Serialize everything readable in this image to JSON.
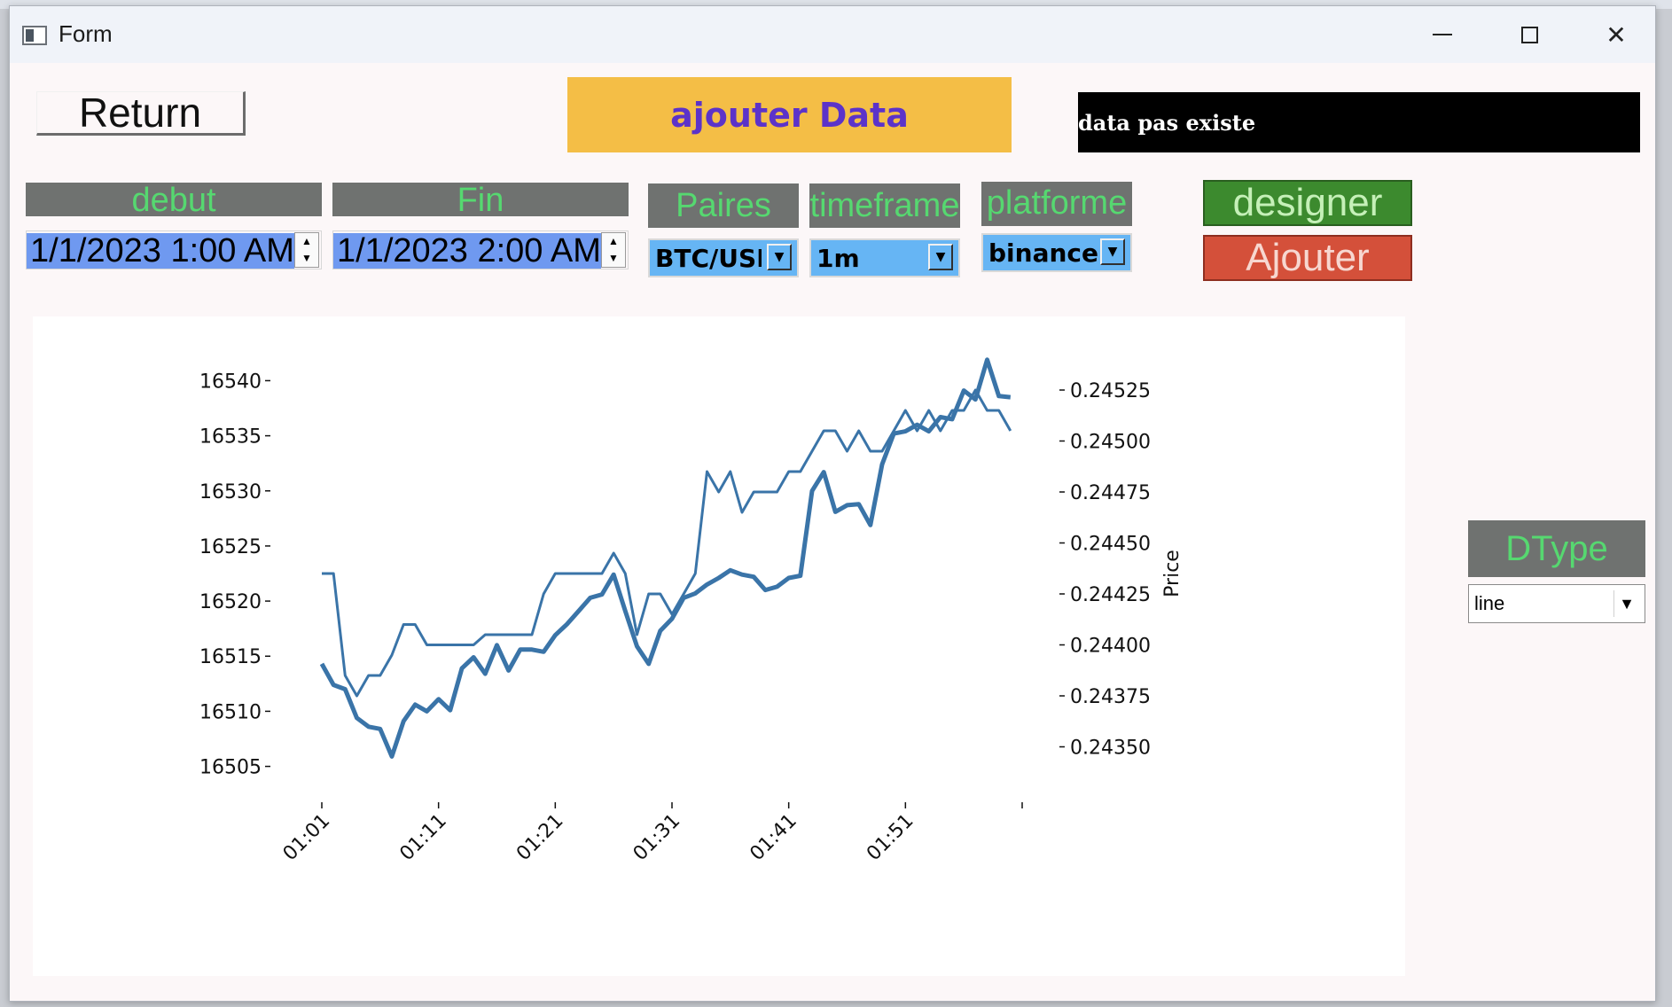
{
  "window": {
    "title": "Form"
  },
  "toolbar": {
    "return_label": "Return",
    "ajouter_data_label": "ajouter Data",
    "status_text": "data pas existe",
    "designer_label": "designer",
    "ajouter_label": "Ajouter"
  },
  "filters": {
    "debut_label": "debut",
    "debut_value": "1/1/2023 1:00 AM",
    "fin_label": "Fin",
    "fin_value": "1/1/2023 2:00 AM",
    "paires_label": "Paires",
    "paires_value": "BTC/USDT",
    "timeframe_label": "timeframe",
    "timeframe_value": "1m",
    "platforme_label": "platforme",
    "platforme_value": "binance",
    "dtype_label": "DType",
    "dtype_value": "line"
  },
  "colors": {
    "accent_yellow": "#f4be46",
    "label_green": "#56d870",
    "combo_blue": "#66b5f4",
    "designer_green": "#3c8a2e",
    "ajouter_red": "#d4503a",
    "line_blue": "#3a74a8"
  },
  "icons": {
    "app": "window-icon",
    "minimize": "minimize-icon",
    "maximize": "maximize-icon",
    "close": "close-icon",
    "spin": "spin-updown-icon",
    "dropdown": "chevron-down-icon"
  },
  "chart_data": {
    "type": "line",
    "title": "",
    "x_tick_labels": [
      "01:01",
      "01:11",
      "01:21",
      "01:31",
      "01:41",
      "01:51"
    ],
    "left_axis": {
      "ticks": [
        16505,
        16510,
        16515,
        16520,
        16525,
        16530,
        16535,
        16540
      ],
      "ylim": [
        16504,
        16541
      ],
      "label": ""
    },
    "right_axis": {
      "ticks": [
        0.2435,
        0.24375,
        0.244,
        0.24425,
        0.2445,
        0.24475,
        0.245,
        0.24525
      ],
      "ylim": [
        0.24335,
        0.24535
      ],
      "label": "Price",
      "tick_labels": [
        "0.24350",
        "0.24375",
        "0.24400",
        "0.24425",
        "0.24450",
        "0.24475",
        "0.24500",
        "0.24525"
      ]
    },
    "x_minutes": [
      0,
      1,
      2,
      3,
      4,
      5,
      6,
      7,
      8,
      9,
      10,
      11,
      12,
      13,
      14,
      15,
      16,
      17,
      18,
      19,
      20,
      21,
      22,
      23,
      24,
      25,
      26,
      27,
      28,
      29,
      30,
      31,
      32,
      33,
      34,
      35,
      36,
      37,
      38,
      39,
      40,
      41,
      42,
      43,
      44,
      45,
      46,
      47,
      48,
      49,
      50,
      51,
      52,
      53,
      54,
      55,
      56,
      57,
      58,
      59
    ],
    "series": [
      {
        "axis": "left",
        "values": [
          16514.3,
          16512.4,
          16512.0,
          16509.4,
          16508.6,
          16508.4,
          16505.9,
          16509.1,
          16510.6,
          16510.0,
          16511.1,
          16510.1,
          16513.9,
          16514.9,
          16513.4,
          16516.0,
          16513.7,
          16515.6,
          16515.6,
          16515.4,
          16516.9,
          16517.9,
          16519.1,
          16520.3,
          16520.6,
          16522.4,
          16519.1,
          16515.9,
          16514.3,
          16517.3,
          16518.4,
          16520.3,
          16520.7,
          16521.5,
          16522.1,
          16522.8,
          16522.4,
          16522.2,
          16521.0,
          16521.3,
          16522.1,
          16522.3,
          16530.0,
          16531.7,
          16528.1,
          16528.7,
          16528.8,
          16526.9,
          16532.4,
          16535.2,
          16535.4,
          16536.0,
          16535.4,
          16536.7,
          16536.5,
          16539.1,
          16538.3,
          16541.9,
          16538.6,
          16538.5
        ],
        "color": "#3a74a8",
        "width": "thick"
      },
      {
        "axis": "right",
        "values": [
          0.24435,
          0.24435,
          0.24385,
          0.24375,
          0.24385,
          0.24385,
          0.24395,
          0.2441,
          0.2441,
          0.244,
          0.244,
          0.244,
          0.244,
          0.244,
          0.24405,
          0.24405,
          0.24405,
          0.24405,
          0.24405,
          0.24425,
          0.24435,
          0.24435,
          0.24435,
          0.24435,
          0.24435,
          0.24445,
          0.24435,
          0.24405,
          0.24425,
          0.24425,
          0.24415,
          0.24425,
          0.24435,
          0.24485,
          0.24475,
          0.24485,
          0.24465,
          0.24475,
          0.24475,
          0.24475,
          0.24485,
          0.24485,
          0.24495,
          0.24505,
          0.24505,
          0.24495,
          0.24505,
          0.24495,
          0.24495,
          0.24505,
          0.24515,
          0.24505,
          0.24515,
          0.24505,
          0.24515,
          0.24515,
          0.24525,
          0.24515,
          0.24515,
          0.24505
        ],
        "color": "#3a74a8",
        "width": "thin"
      }
    ],
    "grid": false,
    "legend": "none"
  }
}
